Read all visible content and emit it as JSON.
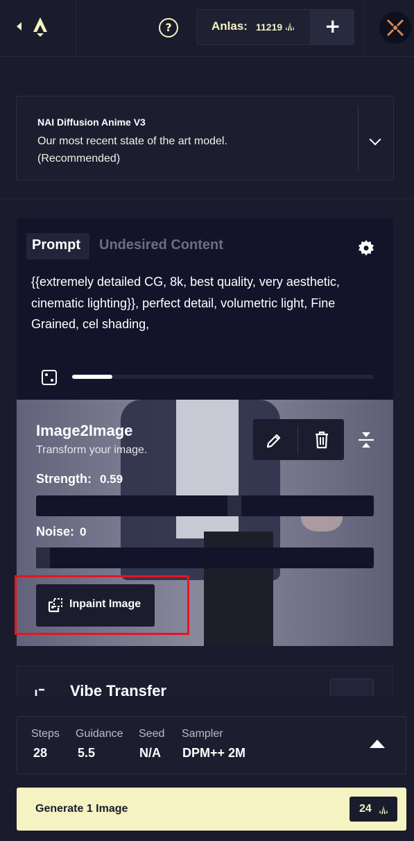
{
  "header": {
    "help_symbol": "?",
    "anlas_label": "Anlas:",
    "anlas_value": "11219",
    "add_symbol": "+"
  },
  "model": {
    "name": "NAI Diffusion Anime V3",
    "description": "Our most recent state of the art model. (Recommended)"
  },
  "prompt": {
    "tabs": [
      "Prompt",
      "Undesired Content"
    ],
    "text": "{{extremely detailed CG, 8k, best quality, very aesthetic, cinematic lighting}}, perfect detail, volumetric light, Fine Grained, cel shading,"
  },
  "image2image": {
    "title": "Image2Image",
    "subtitle": "Transform your image.",
    "strength_label": "Strength:",
    "strength_value": "0.59",
    "noise_label": "Noise:",
    "noise_value": "0",
    "inpaint_label": "Inpaint Image"
  },
  "vibe": {
    "title": "Vibe Transfer"
  },
  "settings": {
    "items": [
      {
        "label": "Steps",
        "value": "28"
      },
      {
        "label": "Guidance",
        "value": "5.5"
      },
      {
        "label": "Seed",
        "value": "N/A"
      },
      {
        "label": "Sampler",
        "value": "DPM++ 2M"
      }
    ]
  },
  "generate": {
    "label": "Generate 1 Image",
    "cost": "24"
  },
  "colors": {
    "background": "#1a1c2d",
    "accent": "#f5f3c2",
    "highlight": "#e8141f"
  }
}
